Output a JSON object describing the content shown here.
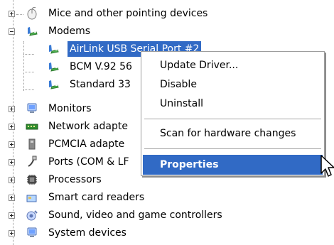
{
  "tree": {
    "items": [
      {
        "label": "Mice and other pointing devices",
        "expand": "plus",
        "icon": "mouse-icon"
      },
      {
        "label": "Modems",
        "expand": "minus",
        "icon": "modem-icon"
      },
      {
        "label": "AirLink USB Serial Port #2",
        "icon": "modem-icon"
      },
      {
        "label": "BCM V.92 56",
        "icon": "modem-icon"
      },
      {
        "label": "Standard 33",
        "icon": "modem-icon"
      },
      {
        "label": "Monitors",
        "expand": "plus",
        "icon": "monitor-icon"
      },
      {
        "label": "Network adapte",
        "expand": "plus",
        "icon": "network-icon"
      },
      {
        "label": "PCMCIA adapte",
        "expand": "plus",
        "icon": "pcmcia-icon"
      },
      {
        "label": "Ports (COM & LF",
        "expand": "plus",
        "icon": "port-icon"
      },
      {
        "label": "Processors",
        "expand": "plus",
        "icon": "processor-icon"
      },
      {
        "label": "Smart card readers",
        "expand": "plus",
        "icon": "smartcard-icon"
      },
      {
        "label": "Sound, video and game controllers",
        "expand": "plus",
        "icon": "sound-icon"
      },
      {
        "label": "System devices",
        "expand": "plus",
        "icon": "system-icon"
      }
    ]
  },
  "context_menu": {
    "items": [
      {
        "label": "Update Driver..."
      },
      {
        "label": "Disable"
      },
      {
        "label": "Uninstall"
      },
      {
        "label": "Scan for hardware changes"
      },
      {
        "label": "Properties"
      }
    ]
  },
  "colors": {
    "selection": "#316ac5"
  }
}
